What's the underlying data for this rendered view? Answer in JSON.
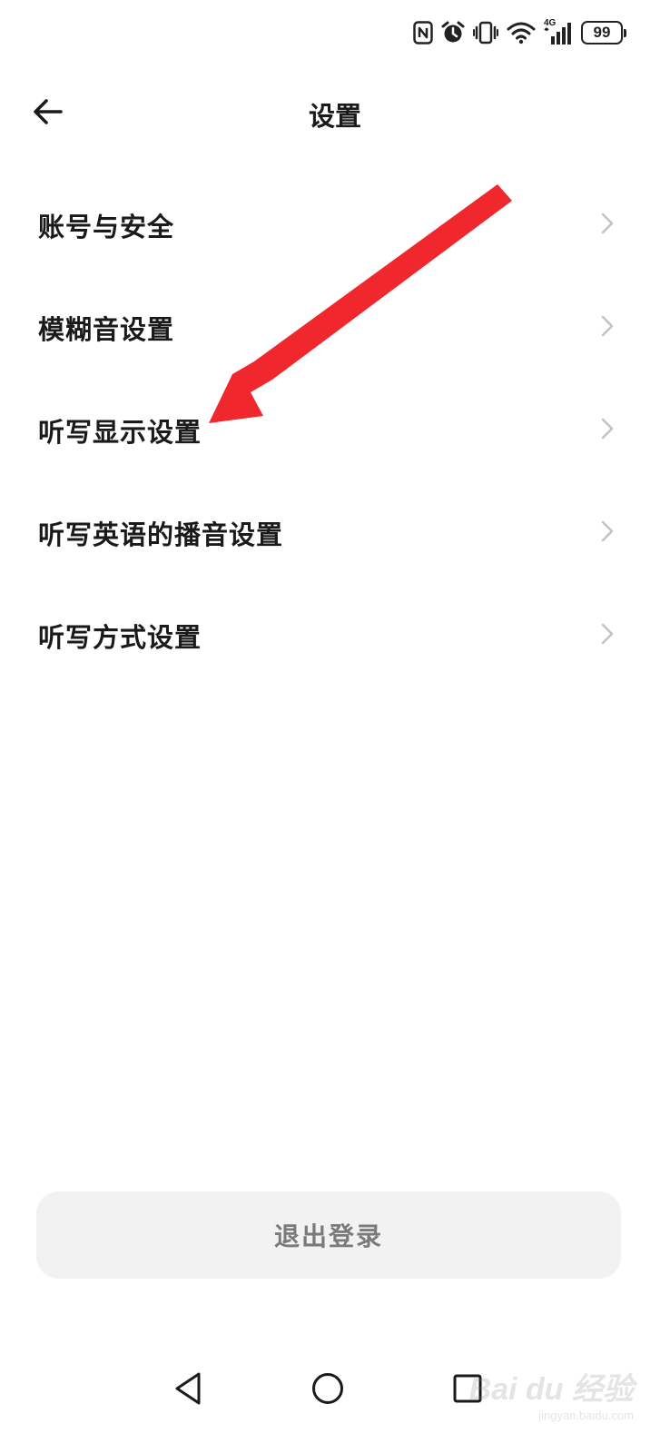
{
  "status_bar": {
    "battery_level": "99",
    "network_label": "4G"
  },
  "header": {
    "title": "设置"
  },
  "settings": {
    "items": [
      {
        "label": "账号与安全"
      },
      {
        "label": "模糊音设置"
      },
      {
        "label": "听写显示设置"
      },
      {
        "label": "听写英语的播音设置"
      },
      {
        "label": "听写方式设置"
      }
    ]
  },
  "footer": {
    "logout_label": "退出登录"
  },
  "watermark": {
    "main": "Bai du 经验",
    "sub": "jingyan.baidu.com"
  },
  "colors": {
    "annotation_arrow": "#f0272d",
    "logout_bg": "#f2f2f2",
    "logout_text": "#7a7a7a"
  }
}
